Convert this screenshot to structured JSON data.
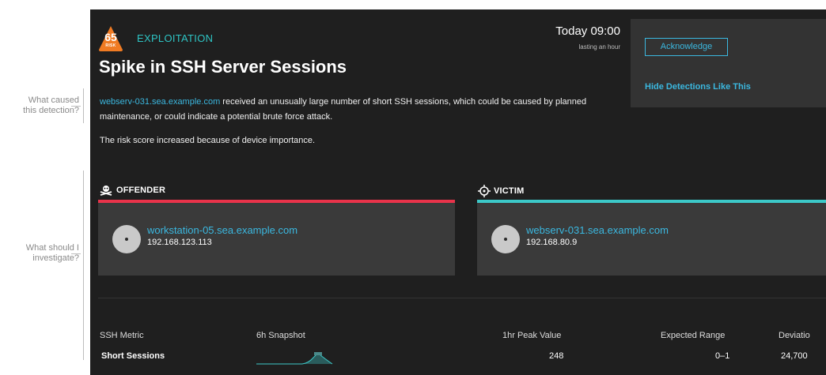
{
  "annotations": {
    "cause": "What caused this detection?",
    "investigate": "What should I investigate?"
  },
  "detection": {
    "risk_score": "65",
    "risk_label": "RISK",
    "category": "EXPLOITATION",
    "title": "Spike in SSH Server Sessions",
    "time": "Today 09:00",
    "duration": "lasting an hour",
    "description_link": "webserv-031.sea.example.com",
    "description_text": " received an unusually large number of short SSH sessions, which could be caused by planned maintenance, or could indicate a potential brute force attack.",
    "risk_note": "The risk score increased because of device importance."
  },
  "actions": {
    "acknowledge": "Acknowledge",
    "hide": "Hide Detections Like This"
  },
  "offender": {
    "heading": "OFFENDER",
    "hostname": "workstation-05.sea.example.com",
    "ip": "192.168.123.113"
  },
  "victim": {
    "heading": "VICTIM",
    "hostname": "webserv-031.sea.example.com",
    "ip": "192.168.80.9"
  },
  "metrics": {
    "headers": [
      "SSH Metric",
      "6h Snapshot",
      "1hr Peak Value",
      "Expected Range",
      "Deviatio"
    ],
    "rows": [
      {
        "metric": "Short Sessions",
        "peak": "248",
        "range": "0–1",
        "deviation": "24,700"
      }
    ]
  },
  "colors": {
    "panel": "#1f1f1f",
    "accent_teal": "#2ec4c4",
    "link_blue": "#3bb8e0",
    "offender_red": "#e8334a",
    "victim_teal": "#3cc8c8",
    "risk_orange": "#f07b23"
  },
  "icons": {
    "risk": "triangle-badge-icon",
    "offender": "skull-crossbones-icon",
    "victim": "target-crosshair-icon"
  }
}
